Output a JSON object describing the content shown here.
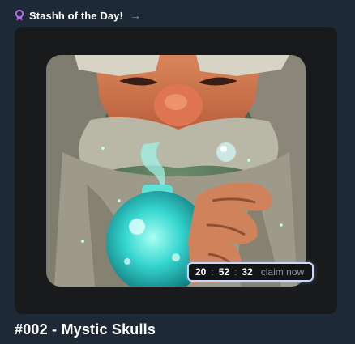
{
  "header": {
    "title": "Stashh of the Day!",
    "arrow": "→",
    "icon": "award-badge-icon"
  },
  "timer": {
    "hours": "20",
    "minutes": "52",
    "seconds": "32",
    "separator": ":",
    "claim_label": "claim now"
  },
  "nft": {
    "title": "#002 - Mystic Skulls",
    "image": "wizard-with-potion-artwork"
  },
  "colors": {
    "background": "#1d2a35",
    "card": "#181a1c",
    "accent": "#b36cf0",
    "timer_border": "#c9d7ff"
  }
}
